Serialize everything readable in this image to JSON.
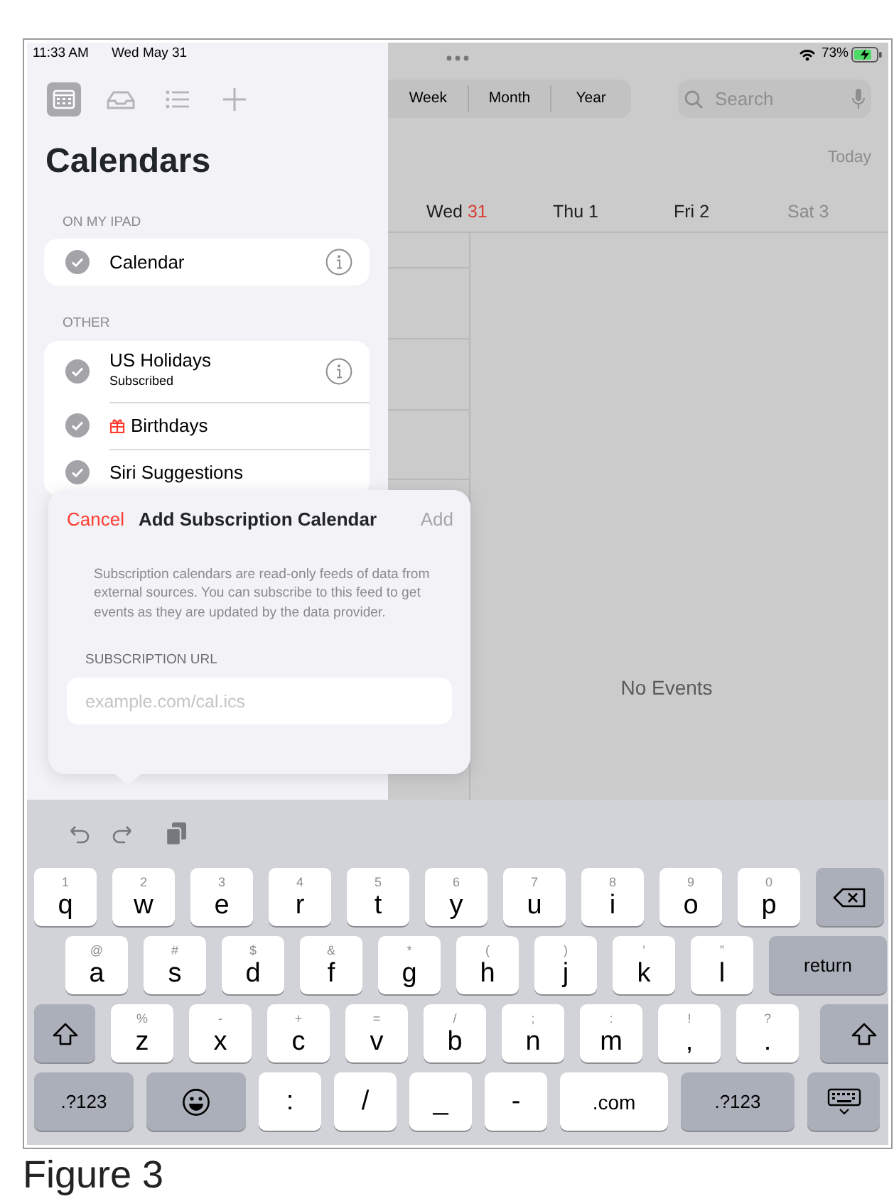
{
  "status_bar": {
    "time": "11:33 AM",
    "date": "Wed May 31",
    "battery": "73%"
  },
  "sidebar": {
    "toolbar": [
      {
        "kind": "calendars",
        "selected": true
      },
      {
        "kind": "inbox",
        "selected": false
      },
      {
        "kind": "list",
        "selected": false
      },
      {
        "kind": "add",
        "selected": false
      }
    ],
    "title": "Calendars",
    "sections": [
      {
        "header": "ON MY IPAD",
        "items": [
          {
            "name": "Calendar",
            "checked": true,
            "info": true
          }
        ]
      },
      {
        "header": "OTHER",
        "items": [
          {
            "name": "US Holidays",
            "subtitle": "Subscribed",
            "checked": true,
            "info": true
          },
          {
            "name": "Birthdays",
            "kind": "birthday",
            "checked": true
          },
          {
            "name": "Siri Suggestions",
            "checked": true
          }
        ]
      }
    ]
  },
  "view_switcher": [
    {
      "label": "Week",
      "selected": false
    },
    {
      "label": "Month",
      "selected": false
    },
    {
      "label": "Year",
      "selected": false
    }
  ],
  "search": {
    "placeholder": "Search"
  },
  "today_button": "Today",
  "days": [
    {
      "day": "Wed",
      "date": "31",
      "today": true,
      "weekend": false
    },
    {
      "day": "Thu",
      "date": "1",
      "today": false,
      "weekend": false
    },
    {
      "day": "Fri",
      "date": "2",
      "today": false,
      "weekend": false
    },
    {
      "day": "Sat",
      "date": "3",
      "today": false,
      "weekend": true
    }
  ],
  "no_events": "No Events",
  "popover": {
    "cancel": "Cancel",
    "title": "Add Subscription Calendar",
    "add": {
      "label": "Add",
      "disabled": true
    },
    "description": "Subscription calendars are read-only feeds of data from external sources. You can subscribe to this feed to get events as they are updated by the data provider.",
    "field_label": "SUBSCRIPTION URL",
    "field": {
      "placeholder": "example.com/cal.ics"
    }
  },
  "keyboard": {
    "rows": [
      {
        "keys": [
          {
            "kind": "letter",
            "label": "q",
            "hint": "1"
          },
          {
            "kind": "letter",
            "label": "w",
            "hint": "2"
          },
          {
            "kind": "letter",
            "label": "e",
            "hint": "3"
          },
          {
            "kind": "letter",
            "label": "r",
            "hint": "4"
          },
          {
            "kind": "letter",
            "label": "t",
            "hint": "5"
          },
          {
            "kind": "letter",
            "label": "y",
            "hint": "6"
          },
          {
            "kind": "letter",
            "label": "u",
            "hint": "7"
          },
          {
            "kind": "letter",
            "label": "i",
            "hint": "8"
          },
          {
            "kind": "letter",
            "label": "o",
            "hint": "9"
          },
          {
            "kind": "letter",
            "label": "p",
            "hint": "0"
          },
          {
            "kind": "delete"
          }
        ]
      },
      {
        "keys": [
          {
            "kind": "letter",
            "label": "a",
            "hint": "@"
          },
          {
            "kind": "letter",
            "label": "s",
            "hint": "#"
          },
          {
            "kind": "letter",
            "label": "d",
            "hint": "$"
          },
          {
            "kind": "letter",
            "label": "f",
            "hint": "&"
          },
          {
            "kind": "letter",
            "label": "g",
            "hint": "*"
          },
          {
            "kind": "letter",
            "label": "h",
            "hint": "("
          },
          {
            "kind": "letter",
            "label": "j",
            "hint": ")"
          },
          {
            "kind": "letter",
            "label": "k",
            "hint": "’"
          },
          {
            "kind": "letter",
            "label": "l",
            "hint": "”"
          },
          {
            "kind": "return",
            "label": "return"
          }
        ]
      },
      {
        "keys": [
          {
            "kind": "shift"
          },
          {
            "kind": "letter",
            "label": "z",
            "hint": "%"
          },
          {
            "kind": "letter",
            "label": "x",
            "hint": "-"
          },
          {
            "kind": "letter",
            "label": "c",
            "hint": "+"
          },
          {
            "kind": "letter",
            "label": "v",
            "hint": "="
          },
          {
            "kind": "letter",
            "label": "b",
            "hint": "/"
          },
          {
            "kind": "letter",
            "label": "n",
            "hint": ";"
          },
          {
            "kind": "letter",
            "label": "m",
            "hint": ":"
          },
          {
            "kind": "letter",
            "label": ",",
            "hint": "!"
          },
          {
            "kind": "letter",
            "label": ".",
            "hint": "?"
          },
          {
            "kind": "shift"
          }
        ]
      },
      {
        "keys": [
          {
            "kind": "numbers",
            "label": ".?123"
          },
          {
            "kind": "emoji"
          },
          {
            "kind": "symbol",
            "label": ":"
          },
          {
            "kind": "symbol",
            "label": "/"
          },
          {
            "kind": "symbol",
            "label": "_"
          },
          {
            "kind": "symbol",
            "label": "-"
          },
          {
            "kind": "dotcom",
            "label": ".com"
          },
          {
            "kind": "numbers",
            "label": ".?123"
          },
          {
            "kind": "dismiss"
          }
        ]
      }
    ]
  },
  "caption": "Figure 3"
}
